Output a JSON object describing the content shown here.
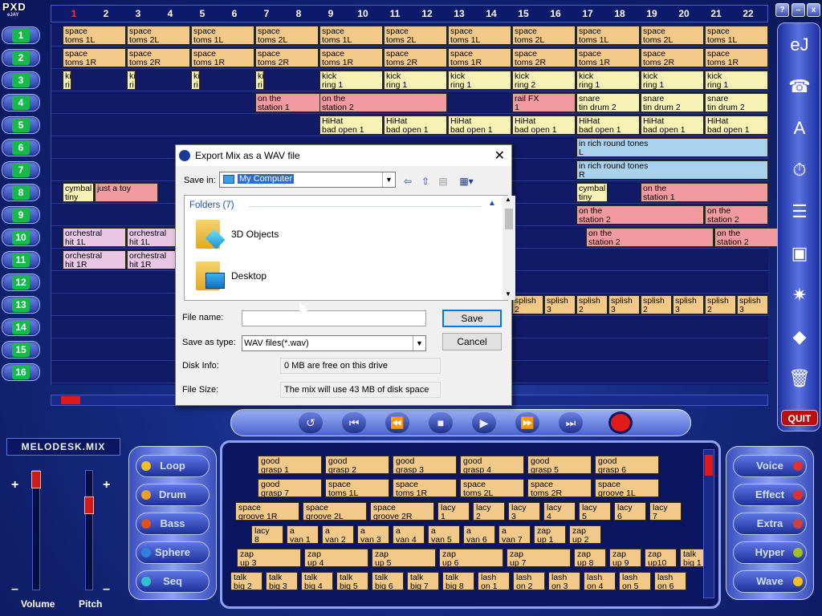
{
  "app": {
    "logo": "PXD",
    "logo_sub": "eJAY"
  },
  "columns": [
    "1",
    "2",
    "3",
    "4",
    "5",
    "6",
    "7",
    "8",
    "9",
    "10",
    "11",
    "12",
    "13",
    "14",
    "15",
    "16",
    "17",
    "18",
    "19",
    "20",
    "21",
    "22"
  ],
  "tracks": [
    {
      "num": "1",
      "on": true
    },
    {
      "num": "2",
      "on": true
    },
    {
      "num": "3",
      "on": true
    },
    {
      "num": "4",
      "on": true
    },
    {
      "num": "5",
      "on": true
    },
    {
      "num": "6",
      "on": true
    },
    {
      "num": "7",
      "on": true
    },
    {
      "num": "8",
      "on": true
    },
    {
      "num": "9",
      "on": true
    },
    {
      "num": "10",
      "on": true
    },
    {
      "num": "11",
      "on": true
    },
    {
      "num": "12",
      "on": true
    },
    {
      "num": "13",
      "on": true
    },
    {
      "num": "14",
      "on": true
    },
    {
      "num": "15",
      "on": true
    },
    {
      "num": "16",
      "on": true
    }
  ],
  "clips": [
    {
      "lane": 0,
      "col": 0,
      "span": 1,
      "c": "or",
      "t1": "space",
      "t2": "toms 1L"
    },
    {
      "lane": 0,
      "col": 1,
      "span": 1,
      "c": "or",
      "t1": "space",
      "t2": "toms 2L"
    },
    {
      "lane": 0,
      "col": 2,
      "span": 1,
      "c": "or",
      "t1": "space",
      "t2": "toms 1L"
    },
    {
      "lane": 0,
      "col": 3,
      "span": 1,
      "c": "or",
      "t1": "space",
      "t2": "toms 2L"
    },
    {
      "lane": 0,
      "col": 4,
      "span": 1,
      "c": "or",
      "t1": "space",
      "t2": "toms 1L"
    },
    {
      "lane": 0,
      "col": 5,
      "span": 1,
      "c": "or",
      "t1": "space",
      "t2": "toms 2L"
    },
    {
      "lane": 0,
      "col": 6,
      "span": 1,
      "c": "or",
      "t1": "space",
      "t2": "toms 1L"
    },
    {
      "lane": 0,
      "col": 7,
      "span": 1,
      "c": "or",
      "t1": "space",
      "t2": "toms 2L"
    },
    {
      "lane": 0,
      "col": 8,
      "span": 1,
      "c": "or",
      "t1": "space",
      "t2": "toms 1L"
    },
    {
      "lane": 0,
      "col": 9,
      "span": 1,
      "c": "or",
      "t1": "space",
      "t2": "toms 2L"
    },
    {
      "lane": 0,
      "col": 10,
      "span": 1,
      "c": "or",
      "t1": "space",
      "t2": "toms 1L"
    },
    {
      "lane": 1,
      "col": 0,
      "span": 1,
      "c": "or",
      "t1": "space",
      "t2": "toms 1R"
    },
    {
      "lane": 1,
      "col": 1,
      "span": 1,
      "c": "or",
      "t1": "space",
      "t2": "toms 2R"
    },
    {
      "lane": 1,
      "col": 2,
      "span": 1,
      "c": "or",
      "t1": "space",
      "t2": "toms 1R"
    },
    {
      "lane": 1,
      "col": 3,
      "span": 1,
      "c": "or",
      "t1": "space",
      "t2": "toms 2R"
    },
    {
      "lane": 1,
      "col": 4,
      "span": 1,
      "c": "or",
      "t1": "space",
      "t2": "toms 1R"
    },
    {
      "lane": 1,
      "col": 5,
      "span": 1,
      "c": "or",
      "t1": "space",
      "t2": "toms 2R"
    },
    {
      "lane": 1,
      "col": 6,
      "span": 1,
      "c": "or",
      "t1": "space",
      "t2": "toms 1R"
    },
    {
      "lane": 1,
      "col": 7,
      "span": 1,
      "c": "or",
      "t1": "space",
      "t2": "toms 2R"
    },
    {
      "lane": 1,
      "col": 8,
      "span": 1,
      "c": "or",
      "t1": "space",
      "t2": "toms 1R"
    },
    {
      "lane": 1,
      "col": 9,
      "span": 1,
      "c": "or",
      "t1": "space",
      "t2": "toms 2R"
    },
    {
      "lane": 1,
      "col": 10,
      "span": 1,
      "c": "or",
      "t1": "space",
      "t2": "toms 1R"
    },
    {
      "lane": 2,
      "col": 0,
      "span": 0.15,
      "c": "ye",
      "t1": "ki",
      "t2": "ri"
    },
    {
      "lane": 2,
      "col": 1,
      "span": 0.15,
      "c": "ye",
      "t1": "ki",
      "t2": "ri"
    },
    {
      "lane": 2,
      "col": 2,
      "span": 0.15,
      "c": "ye",
      "t1": "ki",
      "t2": "ri"
    },
    {
      "lane": 2,
      "col": 3,
      "span": 0.15,
      "c": "ye",
      "t1": "ki",
      "t2": "ri"
    },
    {
      "lane": 2,
      "col": 4,
      "span": 1,
      "c": "ye",
      "t1": "kick",
      "t2": "ring 1"
    },
    {
      "lane": 2,
      "col": 5,
      "span": 1,
      "c": "ye",
      "t1": "kick",
      "t2": "ring 1"
    },
    {
      "lane": 2,
      "col": 6,
      "span": 1,
      "c": "ye",
      "t1": "kick",
      "t2": "ring 1"
    },
    {
      "lane": 2,
      "col": 7,
      "span": 1,
      "c": "ye",
      "t1": "kick",
      "t2": "ring 2"
    },
    {
      "lane": 2,
      "col": 8,
      "span": 1,
      "c": "ye",
      "t1": "kick",
      "t2": "ring 1"
    },
    {
      "lane": 2,
      "col": 9,
      "span": 1,
      "c": "ye",
      "t1": "kick",
      "t2": "ring 1"
    },
    {
      "lane": 2,
      "col": 10,
      "span": 1,
      "c": "ye",
      "t1": "kick",
      "t2": "ring 1"
    },
    {
      "lane": 3,
      "col": 3,
      "span": 2,
      "c": "rd",
      "t1": "on the",
      "t2": "station 1"
    },
    {
      "lane": 3,
      "col": 4,
      "span": 2,
      "c": "rd",
      "t1": "on the",
      "t2": "station 2"
    },
    {
      "lane": 3,
      "col": 7,
      "span": 1,
      "c": "rd",
      "t1": "rail FX",
      "t2": "1"
    },
    {
      "lane": 3,
      "col": 8,
      "span": 1,
      "c": "ye",
      "t1": "snare",
      "t2": "tin drum 2"
    },
    {
      "lane": 3,
      "col": 9,
      "span": 1,
      "c": "ye",
      "t1": "snare",
      "t2": "tin drum 2"
    },
    {
      "lane": 3,
      "col": 10,
      "span": 1,
      "c": "ye",
      "t1": "snare",
      "t2": "tin drum 2"
    },
    {
      "lane": 4,
      "col": 4,
      "span": 1,
      "c": "ye",
      "t1": "HiHat",
      "t2": "bad open 1"
    },
    {
      "lane": 4,
      "col": 5,
      "span": 1,
      "c": "ye",
      "t1": "HiHat",
      "t2": "bad open 1"
    },
    {
      "lane": 4,
      "col": 6,
      "span": 1,
      "c": "ye",
      "t1": "HiHat",
      "t2": "bad open 1"
    },
    {
      "lane": 4,
      "col": 7,
      "span": 1,
      "c": "ye",
      "t1": "HiHat",
      "t2": "bad open 1"
    },
    {
      "lane": 4,
      "col": 8,
      "span": 1,
      "c": "ye",
      "t1": "HiHat",
      "t2": "bad open 1"
    },
    {
      "lane": 4,
      "col": 9,
      "span": 1,
      "c": "ye",
      "t1": "HiHat",
      "t2": "bad open 1"
    },
    {
      "lane": 4,
      "col": 10,
      "span": 1,
      "c": "ye",
      "t1": "HiHat",
      "t2": "bad open 1"
    },
    {
      "lane": 5,
      "col": 8,
      "span": 3,
      "c": "bl",
      "t1": "in rich round tones",
      "t2": "L"
    },
    {
      "lane": 6,
      "col": 8,
      "span": 3,
      "c": "bl",
      "t1": "in rich round tones",
      "t2": "R"
    },
    {
      "lane": 7,
      "col": 0,
      "span": 0.5,
      "c": "ye",
      "t1": "cymbal",
      "t2": "tiny"
    },
    {
      "lane": 7,
      "col": 0.5,
      "span": 1,
      "c": "rd",
      "t1": "just a toy",
      "t2": ""
    },
    {
      "lane": 7,
      "col": 8,
      "span": 0.5,
      "c": "ye",
      "t1": "cymbal",
      "t2": "tiny"
    },
    {
      "lane": 7,
      "col": 9,
      "span": 2,
      "c": "rd",
      "t1": "on the",
      "t2": "station 1"
    },
    {
      "lane": 8,
      "col": 8,
      "span": 2,
      "c": "rd",
      "t1": "on the",
      "t2": "station 2"
    },
    {
      "lane": 8,
      "col": 10,
      "span": 1,
      "c": "rd",
      "t1": "on the",
      "t2": "station 2"
    },
    {
      "lane": 9,
      "col": 0,
      "span": 1,
      "c": "pk",
      "t1": "orchestral",
      "t2": "hit 1L"
    },
    {
      "lane": 9,
      "col": 1,
      "span": 1,
      "c": "pk",
      "t1": "orchestral",
      "t2": "hit 1L"
    },
    {
      "lane": 9,
      "col": 8.15,
      "span": 2,
      "c": "rd",
      "t1": "on the",
      "t2": "station 2"
    },
    {
      "lane": 9,
      "col": 10.15,
      "span": 1,
      "c": "rd",
      "t1": "on the",
      "t2": "station 2"
    },
    {
      "lane": 10,
      "col": 0,
      "span": 1,
      "c": "pk",
      "t1": "orchestral",
      "t2": "hit 1R"
    },
    {
      "lane": 10,
      "col": 1,
      "span": 1,
      "c": "pk",
      "t1": "orchestral",
      "t2": "hit 1R"
    },
    {
      "lane": 12,
      "col": 2,
      "span": 0.5,
      "c": "sp",
      "t1": "splish",
      "t2": "2"
    },
    {
      "lane": 12,
      "col": 7,
      "span": 0.5,
      "c": "sp",
      "t1": "splish",
      "t2": "2"
    },
    {
      "lane": 12,
      "col": 7.5,
      "span": 0.5,
      "c": "sp",
      "t1": "splish",
      "t2": "3"
    },
    {
      "lane": 12,
      "col": 8,
      "span": 0.5,
      "c": "sp",
      "t1": "splish",
      "t2": "2"
    },
    {
      "lane": 12,
      "col": 8.5,
      "span": 0.5,
      "c": "sp",
      "t1": "splish",
      "t2": "3"
    },
    {
      "lane": 12,
      "col": 9,
      "span": 0.5,
      "c": "sp",
      "t1": "splish",
      "t2": "2"
    },
    {
      "lane": 12,
      "col": 9.5,
      "span": 0.5,
      "c": "sp",
      "t1": "splish",
      "t2": "3"
    },
    {
      "lane": 12,
      "col": 10,
      "span": 0.5,
      "c": "sp",
      "t1": "splish",
      "t2": "2"
    },
    {
      "lane": 12,
      "col": 10.5,
      "span": 0.5,
      "c": "sp",
      "t1": "splish",
      "t2": "3"
    }
  ],
  "right_tools": [
    {
      "name": "ejay-logo-icon",
      "glyph": "eJ"
    },
    {
      "name": "phone-icon",
      "glyph": "☎"
    },
    {
      "name": "aaoo-icon",
      "glyph": "A"
    },
    {
      "name": "stopwatch-icon",
      "glyph": "⏱"
    },
    {
      "name": "mixer-icon",
      "glyph": "☰"
    },
    {
      "name": "save-disk-icon",
      "glyph": "▣"
    },
    {
      "name": "new-icon",
      "glyph": "✷"
    },
    {
      "name": "eraser-icon",
      "glyph": "◆"
    },
    {
      "name": "trash-icon",
      "glyph": "🗑"
    }
  ],
  "quit_label": "QUIT",
  "window_btns": {
    "help": "?",
    "min": "–",
    "close": "x"
  },
  "transport": [
    {
      "name": "loop-button",
      "glyph": "↺"
    },
    {
      "name": "rewind-start-button",
      "glyph": "⏮"
    },
    {
      "name": "rewind-button",
      "glyph": "⏪"
    },
    {
      "name": "stop-button",
      "glyph": "■"
    },
    {
      "name": "play-button",
      "glyph": "▶"
    },
    {
      "name": "forward-button",
      "glyph": "⏩"
    },
    {
      "name": "forward-end-button",
      "glyph": "⏭"
    }
  ],
  "mix_name": "MELODESK.MIX",
  "sliders": {
    "volume_label": "Volume",
    "pitch_label": "Pitch",
    "plus": "+",
    "minus": "–"
  },
  "left_categories": [
    {
      "label": "Loop",
      "pill": "#f0c020"
    },
    {
      "label": "Drum",
      "pill": "#f0a020"
    },
    {
      "label": "Bass",
      "pill": "#e05020"
    },
    {
      "label": "Sphere",
      "pill": "#3080e0"
    },
    {
      "label": "Seq",
      "pill": "#30c0d0"
    }
  ],
  "right_categories": [
    {
      "label": "Voice",
      "pill": "#e03030"
    },
    {
      "label": "Effect",
      "pill": "#e03030"
    },
    {
      "label": "Extra",
      "pill": "#d04040"
    },
    {
      "label": "Hyper",
      "pill": "#a0c020"
    },
    {
      "label": "Wave",
      "pill": "#f0c020"
    }
  ],
  "samples": [
    [
      [
        "good",
        "grasp 1"
      ],
      [
        "good",
        "grasp 2"
      ],
      [
        "good",
        "grasp 3"
      ],
      [
        "good",
        "grasp 4"
      ],
      [
        "good",
        "grasp 5"
      ],
      [
        "good",
        "grasp 6"
      ]
    ],
    [
      [
        "good",
        "grasp 7"
      ],
      [
        "space",
        "toms 1L"
      ],
      [
        "space",
        "toms 1R"
      ],
      [
        "space",
        "toms 2L"
      ],
      [
        "space",
        "toms 2R"
      ],
      [
        "space",
        "groove 1L"
      ]
    ],
    [
      [
        "space",
        "groove 1R"
      ],
      [
        "space",
        "groove 2L"
      ],
      [
        "space",
        "groove 2R"
      ],
      [
        "lacy",
        "1"
      ],
      [
        "lacy",
        "2"
      ],
      [
        "lacy",
        "3"
      ],
      [
        "lacy",
        "4"
      ],
      [
        "lacy",
        "5"
      ],
      [
        "lacy",
        "6"
      ],
      [
        "lacy",
        "7"
      ]
    ],
    [
      [
        "lacy",
        "8"
      ],
      [
        "a",
        "van 1"
      ],
      [
        "a",
        "van 2"
      ],
      [
        "a",
        "van 3"
      ],
      [
        "a",
        "van 4"
      ],
      [
        "a",
        "van 5"
      ],
      [
        "a",
        "van 6"
      ],
      [
        "a",
        "van 7"
      ],
      [
        "zap",
        "up 1"
      ],
      [
        "zap",
        "up 2"
      ]
    ],
    [
      [
        "zap",
        "up 3"
      ],
      [
        "zap",
        "up 4"
      ],
      [
        "zap",
        "up 5"
      ],
      [
        "zap",
        "up 6"
      ],
      [
        "zap",
        "up 7"
      ],
      [
        "zap",
        "up 8"
      ],
      [
        "zap",
        "up 9"
      ],
      [
        "zap",
        "up10"
      ],
      [
        "talk",
        "big 1"
      ]
    ],
    [
      [
        "talk",
        "big 2"
      ],
      [
        "talk",
        "big 3"
      ],
      [
        "talk",
        "big 4"
      ],
      [
        "talk",
        "big 5"
      ],
      [
        "talk",
        "big 6"
      ],
      [
        "talk",
        "big 7"
      ],
      [
        "talk",
        "big 8"
      ],
      [
        "lash",
        "on 1"
      ],
      [
        "lash",
        "on 2"
      ],
      [
        "lash",
        "on 3"
      ],
      [
        "lash",
        "on 4"
      ],
      [
        "lash",
        "on 5"
      ],
      [
        "lash",
        "on 6"
      ]
    ]
  ],
  "dialog": {
    "title": "Export Mix as a WAV file",
    "save_in_label": "Save in:",
    "save_in_value": "My Computer",
    "folders_header": "Folders (7)",
    "folders": [
      "3D Objects",
      "Desktop"
    ],
    "file_name_label": "File name:",
    "file_name_value": "",
    "save_as_type_label": "Save as type:",
    "save_as_type_value": "WAV files(*.wav)",
    "disk_info_label": "Disk Info:",
    "disk_info_value": "0 MB are free on this drive",
    "file_size_label": "File Size:",
    "file_size_value": "The mix will use 43 MB of disk space",
    "save_button": "Save",
    "cancel_button": "Cancel",
    "close_glyph": "✕"
  }
}
